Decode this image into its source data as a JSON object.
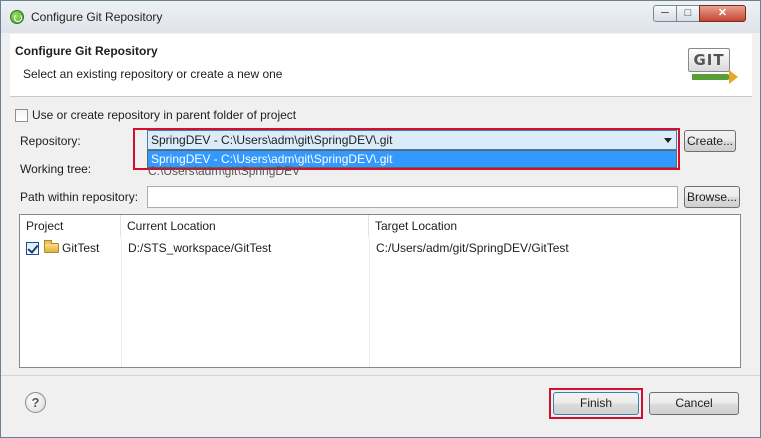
{
  "window": {
    "title": "Configure Git Repository",
    "controls": {
      "minimize": "─",
      "maximize": "□",
      "close": "✕"
    }
  },
  "header": {
    "title": "Configure Git Repository",
    "subtitle": "Select an existing repository or create a new one",
    "logo_text": "GIT"
  },
  "form": {
    "use_parent_label": "Use or create repository in parent folder of project",
    "use_parent_checked": false,
    "repository_label": "Repository:",
    "repository_value": "SpringDEV - C:\\Users\\adm\\git\\SpringDEV\\.git",
    "repository_option": "SpringDEV - C:\\Users\\adm\\git\\SpringDEV\\.git",
    "create_button": "Create...",
    "working_tree_label": "Working tree:",
    "working_tree_value": "C:\\Users\\adm\\git\\SpringDEV",
    "path_label": "Path within repository:",
    "path_value": "",
    "browse_button": "Browse..."
  },
  "table": {
    "columns": [
      "Project",
      "Current Location",
      "Target Location"
    ],
    "rows": [
      {
        "checked": true,
        "project": "GitTest",
        "current": "D:/STS_workspace/GitTest",
        "target": "C:/Users/adm/git/SpringDEV/GitTest"
      }
    ]
  },
  "footer": {
    "help": "?",
    "finish_button": "Finish",
    "cancel_button": "Cancel"
  },
  "colors": {
    "highlight": "#d0102e",
    "selection": "#3399ff"
  },
  "icons": [
    "app-icon",
    "git-logo-icon",
    "folder-icon",
    "help-icon"
  ]
}
